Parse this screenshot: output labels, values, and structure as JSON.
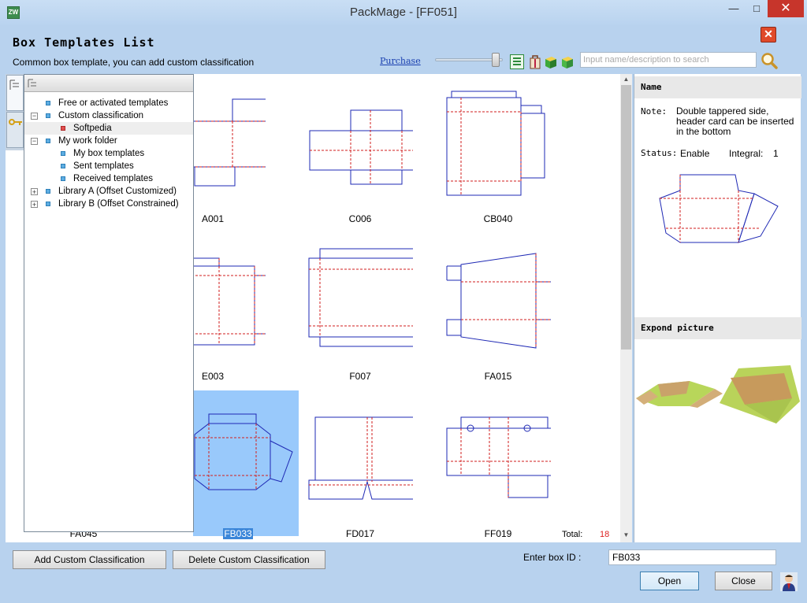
{
  "window": {
    "title": "PackMage - [FF051]",
    "app_icon": "ZW",
    "min": "—",
    "max": "□",
    "close": "✕"
  },
  "header": {
    "title": "Box Templates List",
    "subtitle": "Common box template, you can add custom classification",
    "purchase": "Purchase",
    "search_placeholder": "Input name/description to search",
    "close_glyph": "✕"
  },
  "tree": {
    "items": [
      {
        "label": "Free or activated templates"
      },
      {
        "label": "Custom classification"
      },
      {
        "label": "Softpedia"
      },
      {
        "label": "My work folder"
      },
      {
        "label": "My box templates"
      },
      {
        "label": "Sent templates"
      },
      {
        "label": "Received templates"
      },
      {
        "label": "Library A (Offset Customized)"
      },
      {
        "label": "Library B (Offset Constrained)"
      }
    ]
  },
  "templates": [
    "A001",
    "C006",
    "CB040",
    "E003",
    "F007",
    "FA015",
    "FA045",
    "FB033",
    "FD017",
    "FF019"
  ],
  "selected_template": "FB033",
  "total_label": "Total:",
  "total_value": "18",
  "details": {
    "name_header": "Name",
    "note_label": "Note:",
    "note_text": "Double tappered side, header card can be inserted in the bottom",
    "status_label": "Status:",
    "status_value": "Enable",
    "integral_label": "Integral:",
    "integral_value": "1",
    "expand_header": "Expond picture"
  },
  "footer": {
    "add_button": "Add Custom Classification",
    "delete_button": "Delete Custom Classification",
    "box_id_label": "Enter box ID :",
    "box_id_value": "FB033",
    "open_button": "Open",
    "close_button": "Close"
  },
  "colors": {
    "accent": "#3b86d9",
    "selection": "#99c9fb",
    "outline": "#1e28b4",
    "fold": "#d21e1e",
    "total": "#dd2222"
  }
}
